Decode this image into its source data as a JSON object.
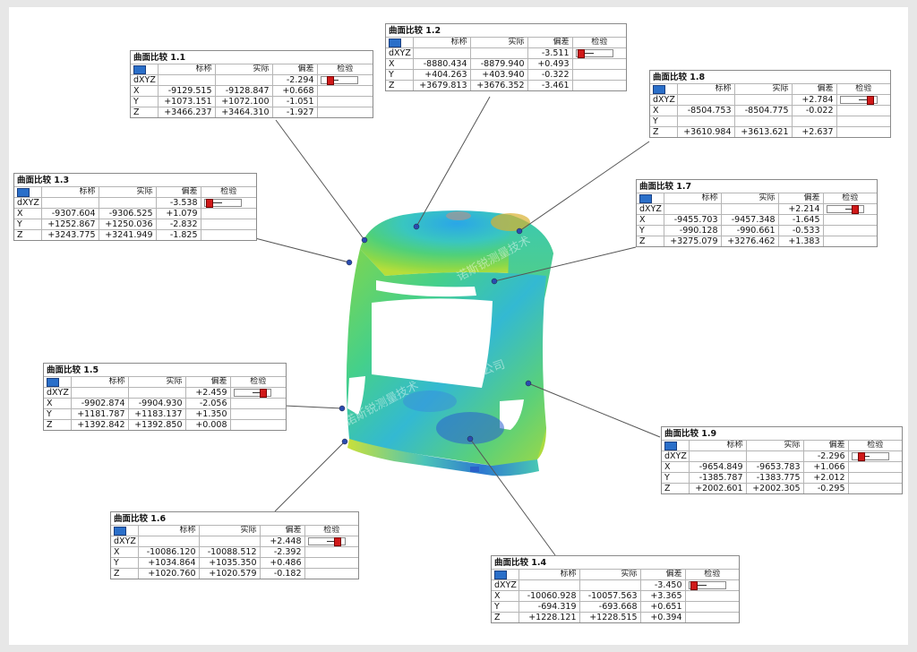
{
  "columns": [
    "标称",
    "实际",
    "偏差",
    "检验"
  ],
  "dxyz_label": "dXYZ",
  "axis_labels": [
    "X",
    "Y",
    "Z"
  ],
  "watermark": "诺斯锐测量技术",
  "watermark_tail": "限公司",
  "colors": {
    "flag": "#2a6fc9",
    "marker": "#d01919"
  },
  "panels": [
    {
      "title": "曲面比较 1.1",
      "dxyz": "-2.294",
      "gauge_level": -0.6,
      "rows": [
        [
          "-9129.515",
          "-9128.847",
          "+0.668"
        ],
        [
          "+1073.151",
          "+1072.100",
          "-1.051"
        ],
        [
          "+3466.237",
          "+3464.310",
          "-1.927"
        ]
      ]
    },
    {
      "title": "曲面比较 1.2",
      "dxyz": "-3.511",
      "gauge_level": -0.9,
      "rows": [
        [
          "-8880.434",
          "-8879.940",
          "+0.493"
        ],
        [
          "+404.263",
          "+403.940",
          "-0.322"
        ],
        [
          "+3679.813",
          "+3676.352",
          "-3.461"
        ]
      ]
    },
    {
      "title": "曲面比较 1.8",
      "dxyz": "+2.784",
      "gauge_level": 0.75,
      "rows": [
        [
          "-8504.753",
          "-8504.775",
          "-0.022"
        ],
        [
          "+3610.984",
          "+3613.621",
          "+2.637"
        ]
      ]
    },
    {
      "title": "曲面比较 1.3",
      "dxyz": "-3.538",
      "gauge_level": -0.9,
      "rows": [
        [
          "-9307.604",
          "-9306.525",
          "+1.079"
        ],
        [
          "+1252.867",
          "+1250.036",
          "-2.832"
        ],
        [
          "+3243.775",
          "+3241.949",
          "-1.825"
        ]
      ]
    },
    {
      "title": "曲面比较 1.7",
      "dxyz": "+2.214",
      "gauge_level": 0.6,
      "rows": [
        [
          "-9455.703",
          "-9457.348",
          "-1.645"
        ],
        [
          "-990.128",
          "-990.661",
          "-0.533"
        ],
        [
          "+3275.079",
          "+3276.462",
          "+1.383"
        ]
      ]
    },
    {
      "title": "曲面比较 1.5",
      "dxyz": "+2.459",
      "gauge_level": 0.65,
      "rows": [
        [
          "-9902.874",
          "-9904.930",
          "-2.056"
        ],
        [
          "+1181.787",
          "+1183.137",
          "+1.350"
        ],
        [
          "+1392.842",
          "+1392.850",
          "+0.008"
        ]
      ]
    },
    {
      "title": "曲面比较 1.9",
      "dxyz": "-2.296",
      "gauge_level": -0.6,
      "rows": [
        [
          "-9654.849",
          "-9653.783",
          "+1.066"
        ],
        [
          "-1385.787",
          "-1383.775",
          "+2.012"
        ],
        [
          "+2002.601",
          "+2002.305",
          "-0.295"
        ]
      ]
    },
    {
      "title": "曲面比较 1.6",
      "dxyz": "+2.448",
      "gauge_level": 0.65,
      "rows": [
        [
          "-10086.120",
          "-10088.512",
          "-2.392"
        ],
        [
          "+1034.864",
          "+1035.350",
          "+0.486"
        ],
        [
          "+1020.760",
          "+1020.579",
          "-0.182"
        ]
      ]
    },
    {
      "title": "曲面比较 1.4",
      "dxyz": "-3.450",
      "gauge_level": -0.9,
      "rows": [
        [
          "-10060.928",
          "-10057.563",
          "+3.365"
        ],
        [
          "-694.319",
          "-693.668",
          "+0.651"
        ],
        [
          "+1228.121",
          "+1228.515",
          "+0.394"
        ]
      ]
    }
  ]
}
